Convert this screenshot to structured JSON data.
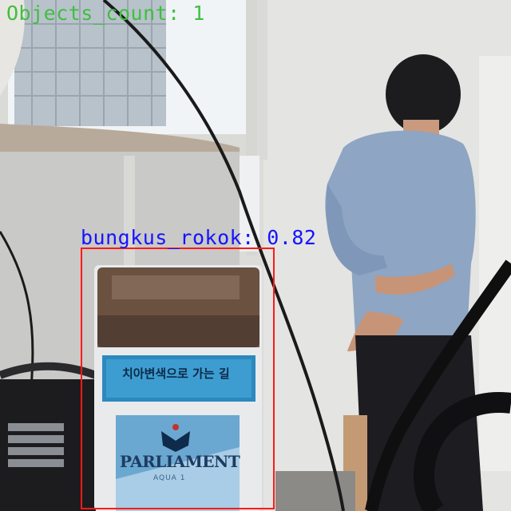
{
  "overlay": {
    "objects_count_text": "Objects_count: 1",
    "objects_count_color": "#3fbf3f"
  },
  "detection": {
    "label_text": "bungkus_rokok: 0.82",
    "label_color": "#1414ff",
    "box_color": "#ff1a1a"
  },
  "pack": {
    "korean_text": "치아변색으로 가는 길",
    "brand_text": "PARLIAMENT",
    "sub_text": "AQUA 1"
  },
  "colors": {
    "wall": "#e6e6e4",
    "window_light": "#f4f6f8",
    "shirt": "#8fa6c4",
    "pants": "#1e1e22",
    "pack_blue": "#5f9fcc"
  }
}
